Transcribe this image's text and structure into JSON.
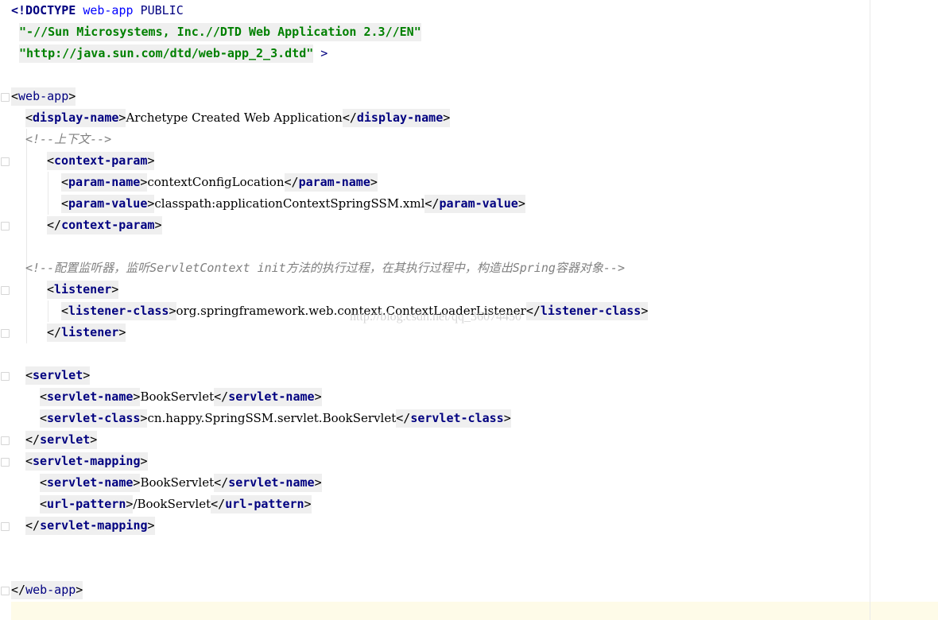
{
  "editor": {
    "doctype": {
      "open": "<!DOCTYPE",
      "root": "web-app",
      "public": "PUBLIC",
      "fpi": "\"-//Sun Microsystems, Inc.//DTD Web Application 2.3//EN\"",
      "dtd_url": "\"http://java.sun.com/dtd/web-app_2_3.dtd\"",
      "close": ">"
    },
    "tags": {
      "web_app": "web-app",
      "display_name": "display-name",
      "context_param": "context-param",
      "param_name": "param-name",
      "param_value": "param-value",
      "listener": "listener",
      "listener_class": "listener-class",
      "servlet": "servlet",
      "servlet_name": "servlet-name",
      "servlet_class": "servlet-class",
      "servlet_mapping": "servlet-mapping",
      "url_pattern": "url-pattern"
    },
    "values": {
      "display_name": "Archetype Created Web Application",
      "context_param_name": "contextConfigLocation",
      "context_param_value": "classpath:applicationContextSpringSSM.xml",
      "listener_class": "org.springframework.web.context.ContextLoaderListener",
      "servlet_name": "BookServlet",
      "servlet_class": "cn.happy.SpringSSM.servlet.BookServlet",
      "mapping_servlet_name": "BookServlet",
      "url_pattern": "/BookServlet"
    },
    "comments": {
      "context": "<!--上下文-->",
      "listener": "<!--配置监听器，监听ServletContext init方法的执行过程，在其执行过程中，构造出Spring容器对象-->"
    },
    "watermark": "http://blog.csdn.net/qq_36074450"
  }
}
